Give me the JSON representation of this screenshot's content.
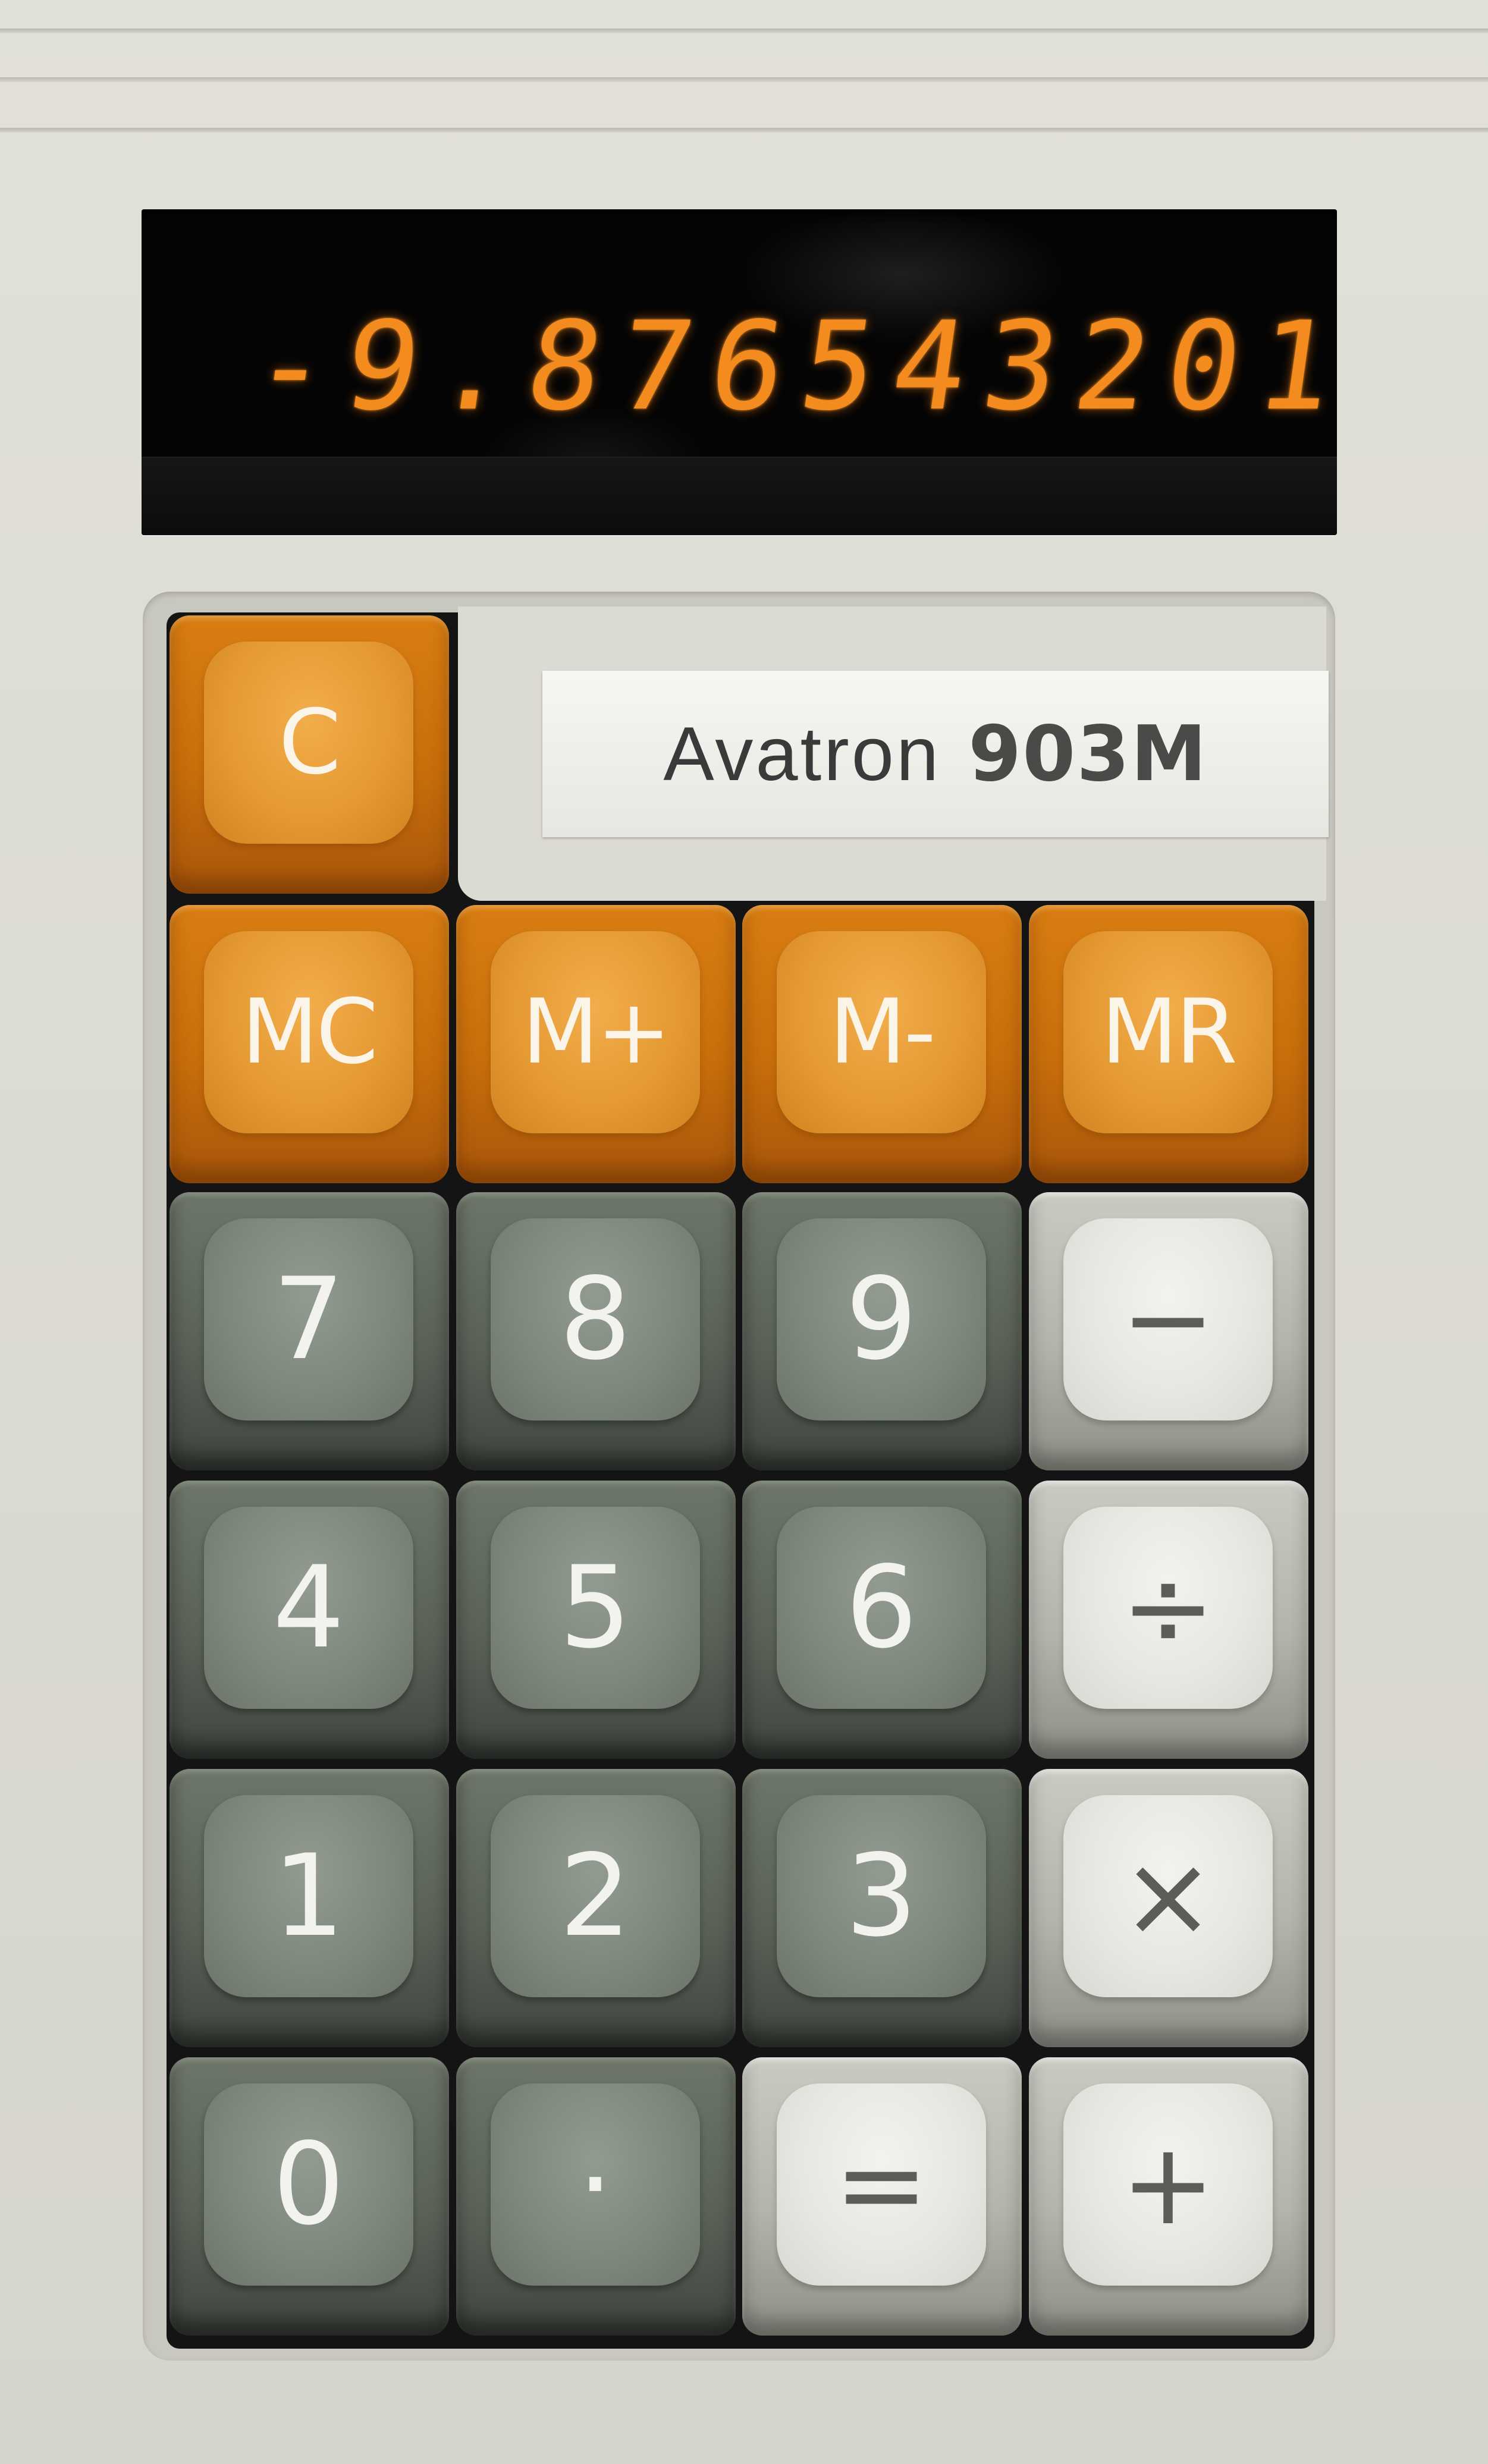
{
  "display": {
    "readout": "-9.876543201"
  },
  "brand": {
    "name": "Avatron",
    "model": "903M"
  },
  "keys": {
    "clear": "C",
    "memory_clear": "MC",
    "memory_add": "M+",
    "memory_subtract": "M-",
    "memory_recall": "MR",
    "seven": "7",
    "eight": "8",
    "nine": "9",
    "subtract": "−",
    "four": "4",
    "five": "5",
    "six": "6",
    "divide": "÷",
    "one": "1",
    "two": "2",
    "three": "3",
    "multiply": "×",
    "zero": "0",
    "decimal": "·",
    "equals": "=",
    "add": "+"
  },
  "colors": {
    "body": "#dcdbd3",
    "display_background": "#050505",
    "display_digits": "#f38b1e",
    "orange_key": "#e59a33",
    "gray_key": "#7f887d",
    "white_key": "#e6e7e1",
    "brand_label": "#f2f2ee"
  }
}
